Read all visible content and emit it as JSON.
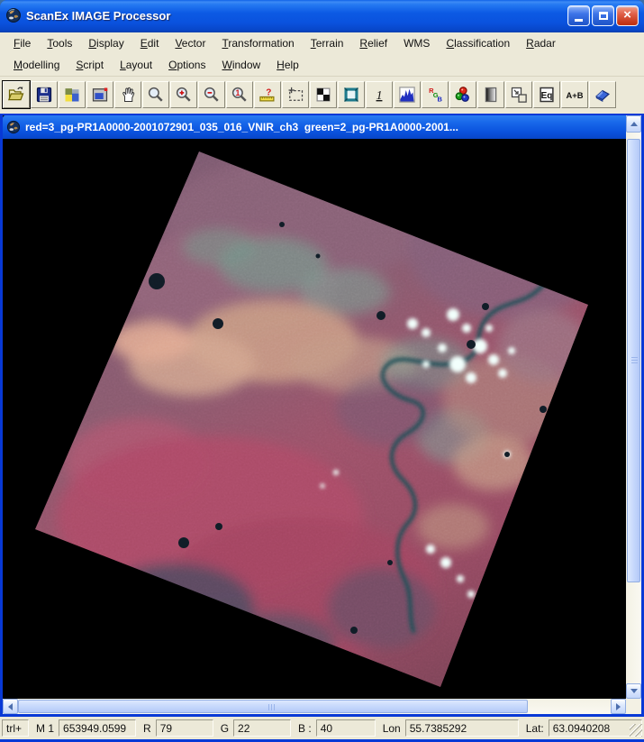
{
  "window": {
    "title": "ScanEx IMAGE Processor"
  },
  "menu": {
    "row1": [
      {
        "label": "File",
        "u": 0
      },
      {
        "label": "Tools",
        "u": 0
      },
      {
        "label": "Display",
        "u": 0
      },
      {
        "label": "Edit",
        "u": 0
      },
      {
        "label": "Vector",
        "u": 0
      },
      {
        "label": "Transformation",
        "u": 0
      },
      {
        "label": "Terrain",
        "u": 0
      },
      {
        "label": "Relief",
        "u": 0
      },
      {
        "label": "WMS",
        "u": -1
      },
      {
        "label": "Classification",
        "u": 0
      },
      {
        "label": "Radar",
        "u": 0
      }
    ],
    "row2": [
      {
        "label": "Modelling",
        "u": 0
      },
      {
        "label": "Script",
        "u": 0
      },
      {
        "label": "Layout",
        "u": 0
      },
      {
        "label": "Options",
        "u": 0
      },
      {
        "label": "Window",
        "u": 0
      },
      {
        "label": "Help",
        "u": 0
      }
    ]
  },
  "toolbar": {
    "icons": [
      "open-folder",
      "save",
      "image",
      "display-settings",
      "pan-hand",
      "zoom",
      "zoom-in",
      "zoom-out",
      "zoom-one",
      "measure-ruler",
      "select-region",
      "tile-quadrants",
      "full-extent-frame",
      "one-to-one",
      "histogram",
      "rgb-compose",
      "color-channels",
      "gradient-stretch",
      "new-window",
      "equalize",
      "image-arithmetic",
      "eraser"
    ],
    "one_glyph": "1",
    "question_glyph": "?",
    "r_glyph": "R",
    "g_glyph": "G",
    "b_glyph": "B",
    "eq_label": "Eq",
    "ab_label": "A+B"
  },
  "document_window": {
    "title": "red=3_pg-PR1A0000-2001072901_035_016_VNIR_ch3  green=2_pg-PR1A0000-2001..."
  },
  "statusbar": {
    "left": "trl+",
    "scale_label": "M 1",
    "scale_value": "653949.0599",
    "r_label": "R",
    "r_value": "79",
    "g_label": "G",
    "g_value": "22",
    "b_label": "B :",
    "b_value": "40",
    "lon_label": "Lon",
    "lon_value": "55.7385292",
    "lat_label": "Lat:",
    "lat_value": "63.0940208"
  },
  "colors": {
    "titlebar_blue": "#0a52de",
    "frame_blue": "#0839d6",
    "menu_bg": "#ece9d8",
    "close_red": "#d24532",
    "canvas_black": "#000000",
    "scroll_thumb": "#c6d8fc",
    "image_crimson": "#a34660",
    "image_mauve": "#8a5a6e",
    "image_salmon": "#c99a84",
    "image_teal": "#6f9a8a",
    "river_teal": "#1d4e55"
  }
}
